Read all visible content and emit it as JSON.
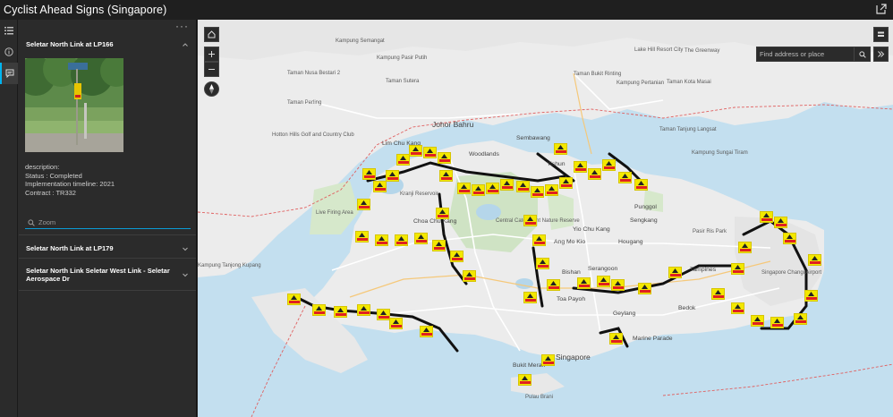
{
  "app": {
    "title": "Cyclist Ahead Signs (Singapore)"
  },
  "rail": {
    "items": [
      "list-icon",
      "info-icon",
      "comment-icon"
    ]
  },
  "panel": {
    "more": "···",
    "selected": {
      "title": "Seletar North Link at LP166",
      "description_label": "description:",
      "status": "Status : Completed",
      "timeline": "Implementation timeline: 2021",
      "contract": "Contract : TR332",
      "zoom_label": "Zoom"
    },
    "items": [
      {
        "title": "Seletar North Link at LP179"
      },
      {
        "title": "Seletar North Link Seletar West Link - Seletar Aerospace Dr"
      }
    ]
  },
  "map": {
    "search_placeholder": "Find address or place",
    "labels": {
      "johor_bahru": "Johor Bahru",
      "singapore": "Singapore",
      "woodlands": "Woodlands",
      "sembawang": "Sembawang",
      "yishun": "Yishun",
      "punggol": "Punggol",
      "sengkang": "Sengkang",
      "yio_chu_kang": "Yio Chu Kang",
      "ang_mo_kio": "Ang Mo Kio",
      "hougang": "Hougang",
      "serangoon": "Serangoon",
      "bishan": "Bishan",
      "toa_payoh": "Toa Payoh",
      "geylang": "Geylang",
      "bedok": "Bedok",
      "tampines": "Tampines",
      "marine_parade": "Marine Parade",
      "choa_chu_kang": "Choa Chu Kang",
      "lim_chu_kang": "Lim Chu Kang",
      "bukit_merah": "Bukit Merah",
      "pulau_brani": "Pulau Brani",
      "taman_perling": "Taman Perling",
      "kampung_pasir": "Kampung Pasir Putih",
      "taman_nusa": "Taman Nusa Bestari 2",
      "taman_sutera": "Taman Sutera",
      "taman_danga": "Taman Danga Bay",
      "kampung_semangat": "Kampung Semangat",
      "kampung_tanjong": "Kampung Tanjong Kupang",
      "lake_hill": "Lake Hill Resort City",
      "the_greenway": "The Greenway",
      "taman_bukit": "Taman Bukit Rinting",
      "kampung_pertanian": "Kampung Pertanian",
      "taman_kota": "Taman Kota Masai",
      "tanjung_langsat": "Taman Tanjung Langsat",
      "kampung_sungai": "Kampung Sungai Tiram",
      "pasir_ris": "Pasir Ris Park",
      "changi": "Singapore Changi Airport",
      "kranji": "Kranji Reservoir",
      "central": "Central Catchment Nature Reserve",
      "live_firing": "Live Firing Area",
      "hotton": "Hotton Hills Golf and Country Club",
      "mac_ritchie": "MacRitchie",
      "upper_tiram": "Tiram",
      "tuas": "Tuas Gulf",
      "tengah": "Tengah",
      "bukit_timah": "Bukit Timah Nature Reserve"
    },
    "colors": {
      "water": "#c3dfef",
      "land": "#ececec",
      "park": "#cfe3c4",
      "route": "#111111",
      "sign": "#f3e800"
    }
  }
}
